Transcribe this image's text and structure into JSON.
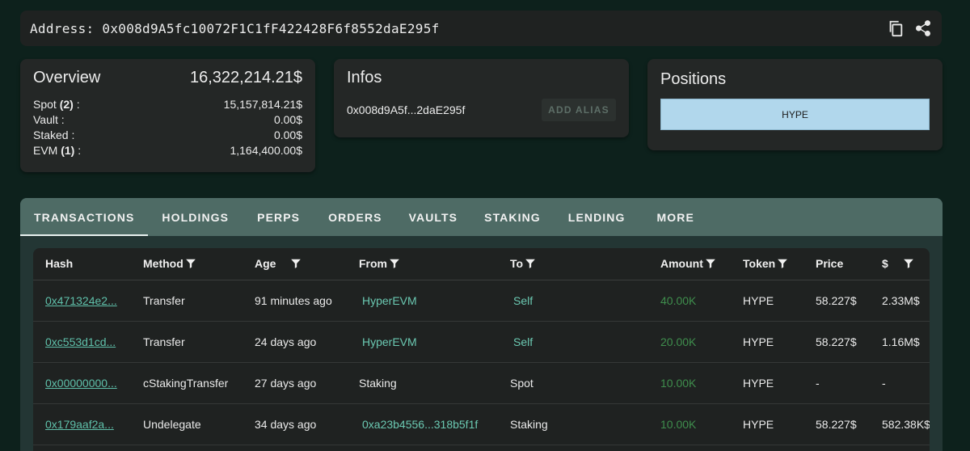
{
  "address_bar": {
    "label": "Address: 0x008d9A5fc10072F1C1fF422428F6f8552daE295f",
    "copy_icon": "copy-icon",
    "share_icon": "share-icon"
  },
  "overview": {
    "title": "Overview",
    "total": "16,322,214.21$",
    "rows": [
      {
        "label": "Spot ",
        "count": "(2)",
        "suffix": " :",
        "value": "15,157,814.21$"
      },
      {
        "label": "Vault :",
        "count": "",
        "suffix": "",
        "value": "0.00$"
      },
      {
        "label": "Staked :",
        "count": "",
        "suffix": "",
        "value": "0.00$"
      },
      {
        "label": "EVM ",
        "count": "(1)",
        "suffix": " :",
        "value": "1,164,400.00$"
      }
    ]
  },
  "infos": {
    "title": "Infos",
    "short_address": "0x008d9A5f...2daE295f",
    "alias_button": "ADD ALIAS"
  },
  "positions": {
    "title": "Positions",
    "items": [
      "HYPE"
    ],
    "chip_color": "#b1d7ec"
  },
  "tabs": [
    "TRANSACTIONS",
    "HOLDINGS",
    "PERPS",
    "ORDERS",
    "VAULTS",
    "STAKING",
    "LENDING",
    "MORE"
  ],
  "table": {
    "headers": [
      "Hash",
      "Method",
      "Age",
      "From",
      "To",
      "Amount",
      "Token",
      "Price",
      "$"
    ],
    "rows": [
      {
        "hash": "0x471324e2...",
        "method": "Transfer",
        "age": "91 minutes ago",
        "from": "HyperEVM",
        "to": "Self",
        "amount": "40.00K",
        "token": "HYPE",
        "price": "58.227$",
        "usd": "2.33M$"
      },
      {
        "hash": "0xc553d1cd...",
        "method": "Transfer",
        "age": "24 days ago",
        "from": "HyperEVM",
        "to": "Self",
        "amount": "20.00K",
        "token": "HYPE",
        "price": "58.227$",
        "usd": "1.16M$"
      },
      {
        "hash": "0x00000000...",
        "method": "cStakingTransfer",
        "age": "27 days ago",
        "from": "Staking",
        "to": "Spot",
        "amount": "10.00K",
        "token": "HYPE",
        "price": "-",
        "usd": "-"
      },
      {
        "hash": "0x179aaf2a...",
        "method": "Undelegate",
        "age": "34 days ago",
        "from": "0xa23b4556...318b5f1f",
        "to": "Staking",
        "amount": "10.00K",
        "token": "HYPE",
        "price": "58.227$",
        "usd": "582.38K$"
      }
    ]
  },
  "colors": {
    "background": "#0d211c",
    "card": "#242726",
    "tab_bar": "#4e6b65",
    "link": "#5fc0aa",
    "amount": "#3f8e4d"
  }
}
